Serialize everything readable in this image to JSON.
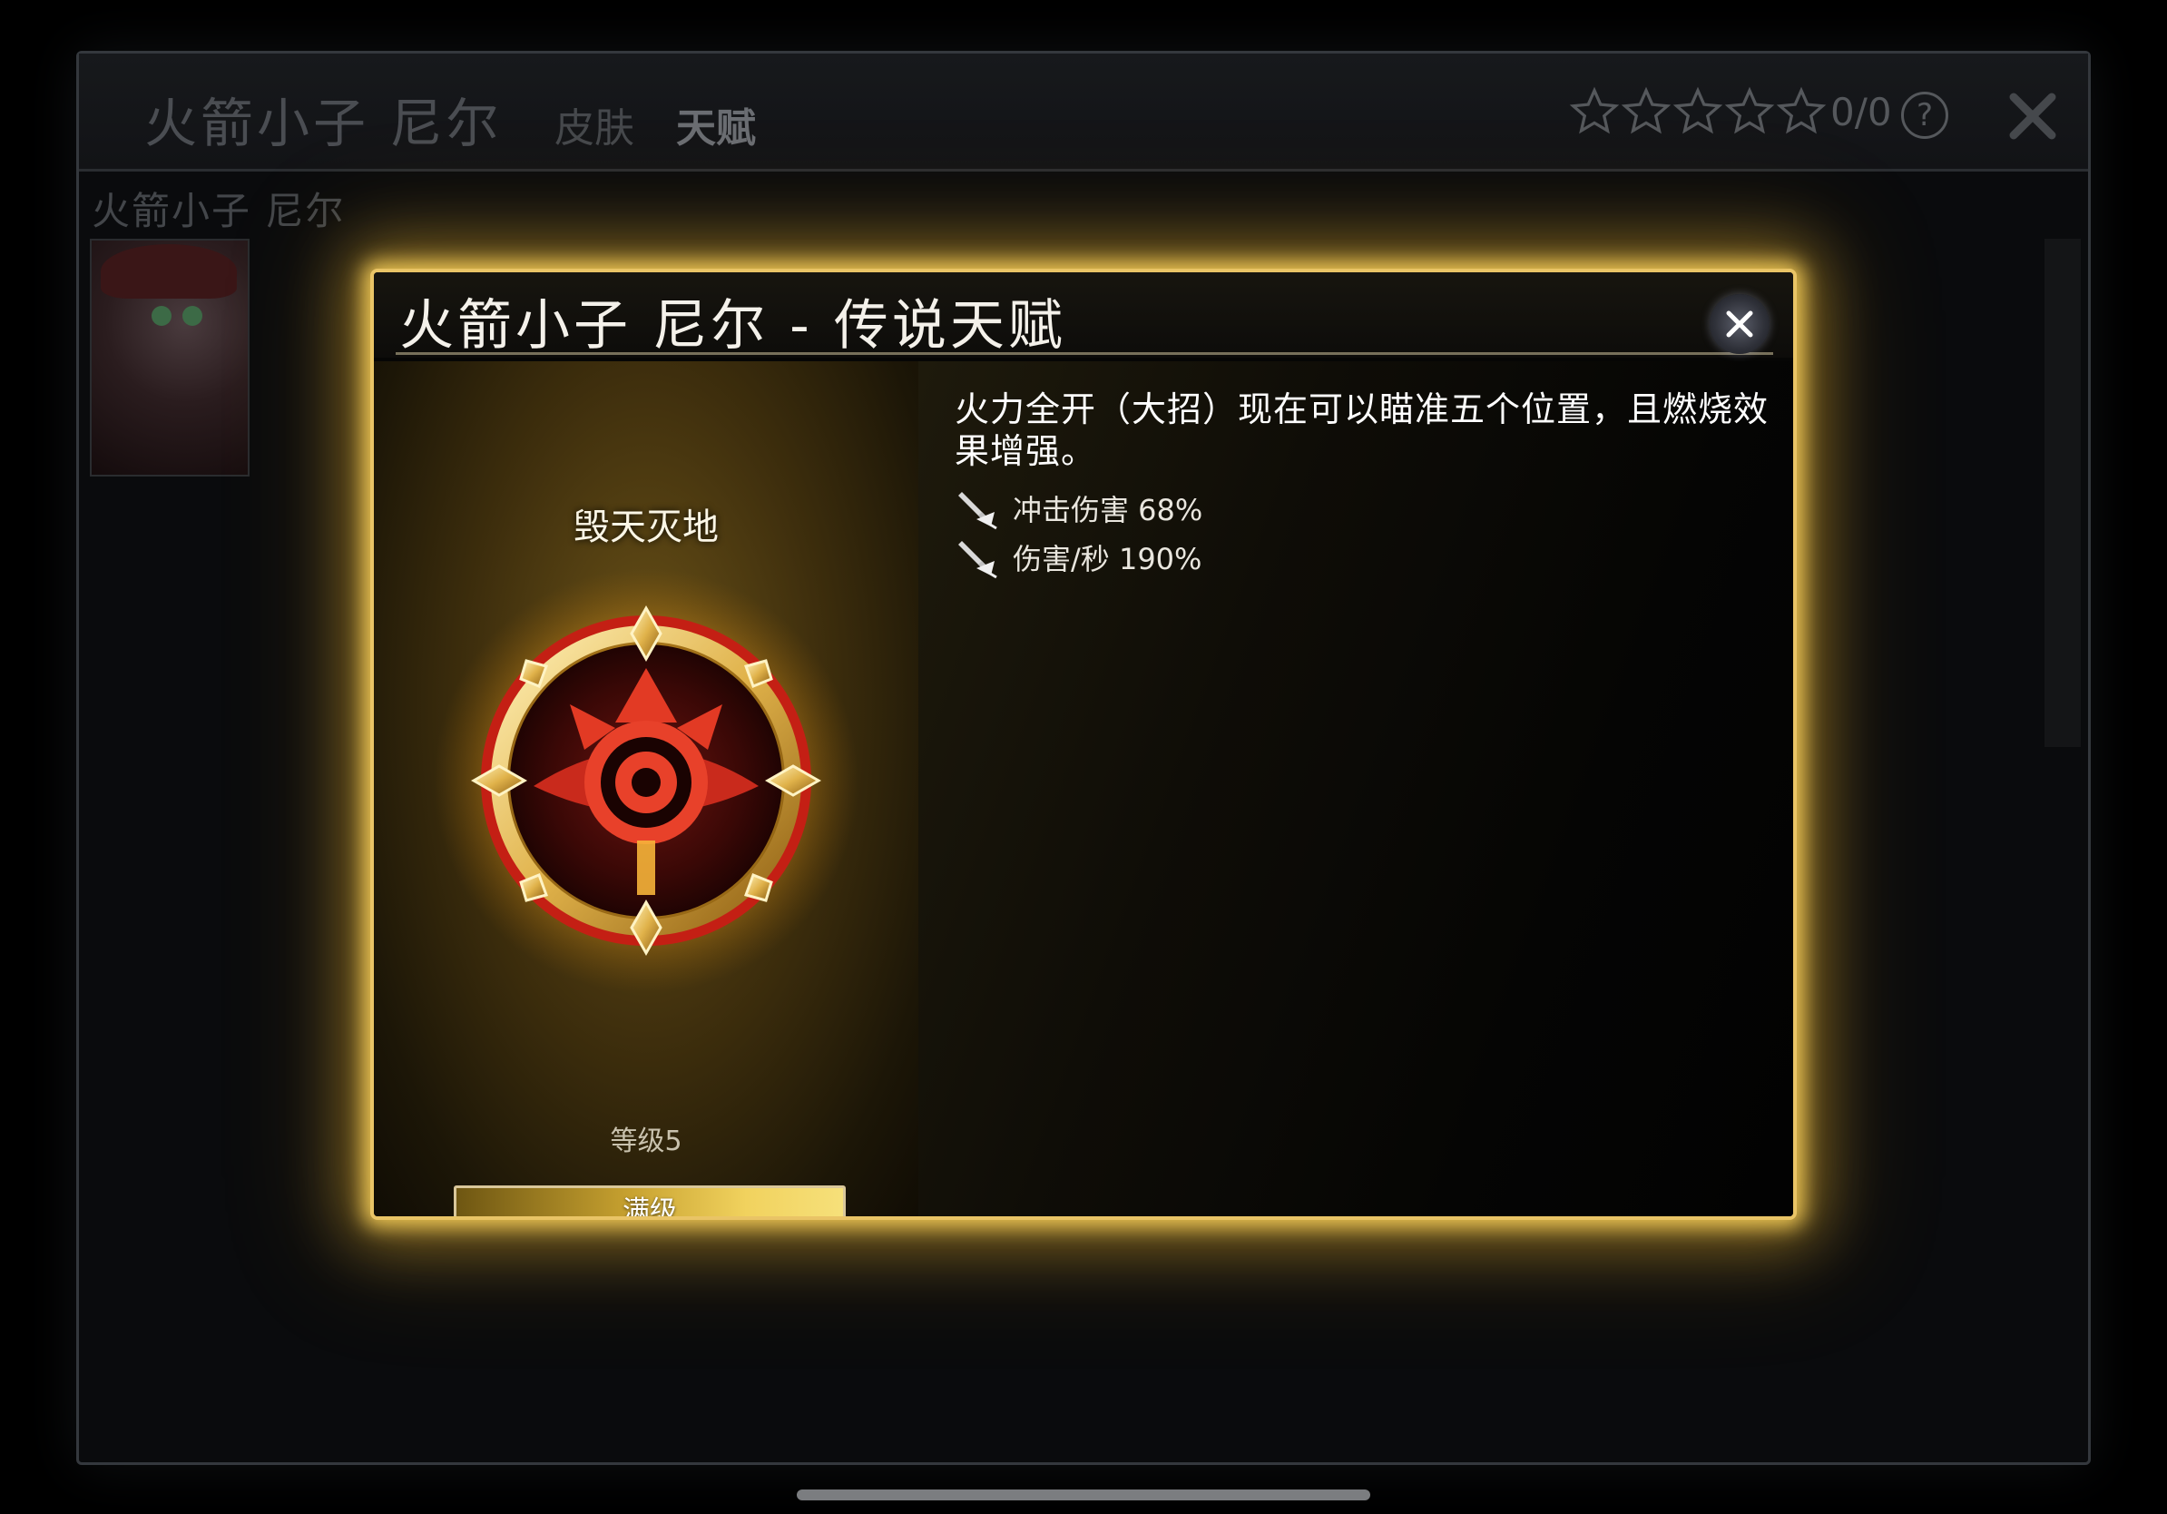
{
  "background": {
    "title": "火箭小子 尼尔",
    "tabs": [
      {
        "label": "皮肤"
      },
      {
        "label": "天赋"
      }
    ],
    "rating": {
      "stars_total": 5,
      "stars_filled": 0,
      "count_text": "0/0"
    },
    "help_symbol": "?",
    "subtitle": "火箭小子 尼尔"
  },
  "modal": {
    "title": "火箭小子 尼尔 - 传说天赋",
    "talent": {
      "name": "毁天灭地",
      "level_label": "等级5",
      "max_button_label": "满级",
      "description": "火力全开（大招）现在可以瞄准五个位置，且燃烧效果增强。",
      "stats": [
        {
          "icon": "sword-icon",
          "text": "冲击伤害 68%"
        },
        {
          "icon": "sword-icon",
          "text": "伤害/秒 190%"
        }
      ]
    }
  },
  "colors": {
    "accent_gold": "#e9c466",
    "emblem_red": "#b8231b"
  }
}
